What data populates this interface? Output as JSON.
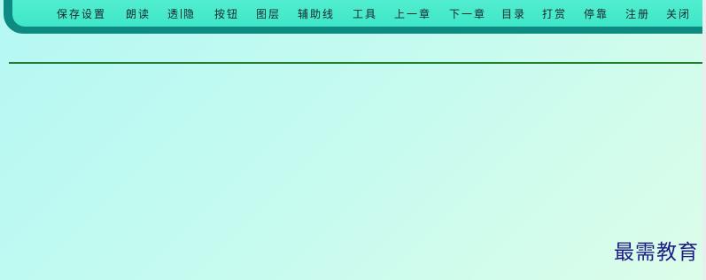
{
  "menu": {
    "save_settings": "保存设置",
    "read_aloud": "朗读",
    "transparent": "透",
    "hide": "隐",
    "buttons": "按钮",
    "layers": "图层",
    "guides": "辅助线",
    "tools": "工具",
    "prev_chapter": "上一章",
    "next_chapter": "下一章",
    "contents": "目录",
    "tip": "打赏",
    "dock": "停靠",
    "register": "注册",
    "close": "关闭"
  },
  "watermark": "最需教育",
  "colors": {
    "toolbar_frame": "#0d8a82",
    "toolbar_face": "#4eecd0",
    "divider": "#1f7f2e",
    "background": "#c0faf0",
    "watermark": "#1d1b86"
  }
}
